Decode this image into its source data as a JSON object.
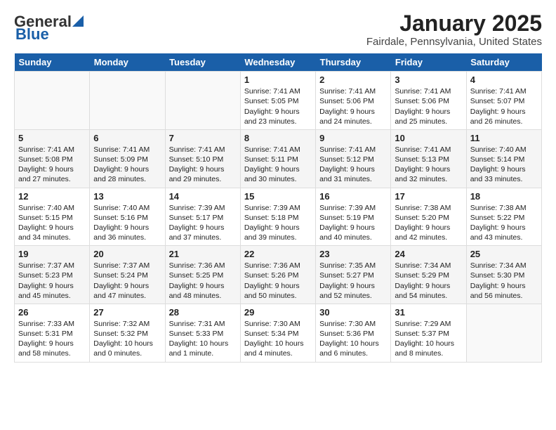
{
  "header": {
    "logo_general": "General",
    "logo_blue": "Blue",
    "month": "January 2025",
    "location": "Fairdale, Pennsylvania, United States"
  },
  "weekdays": [
    "Sunday",
    "Monday",
    "Tuesday",
    "Wednesday",
    "Thursday",
    "Friday",
    "Saturday"
  ],
  "weeks": [
    [
      {
        "day": "",
        "content": ""
      },
      {
        "day": "",
        "content": ""
      },
      {
        "day": "",
        "content": ""
      },
      {
        "day": "1",
        "content": "Sunrise: 7:41 AM\nSunset: 5:05 PM\nDaylight: 9 hours\nand 23 minutes."
      },
      {
        "day": "2",
        "content": "Sunrise: 7:41 AM\nSunset: 5:06 PM\nDaylight: 9 hours\nand 24 minutes."
      },
      {
        "day": "3",
        "content": "Sunrise: 7:41 AM\nSunset: 5:06 PM\nDaylight: 9 hours\nand 25 minutes."
      },
      {
        "day": "4",
        "content": "Sunrise: 7:41 AM\nSunset: 5:07 PM\nDaylight: 9 hours\nand 26 minutes."
      }
    ],
    [
      {
        "day": "5",
        "content": "Sunrise: 7:41 AM\nSunset: 5:08 PM\nDaylight: 9 hours\nand 27 minutes."
      },
      {
        "day": "6",
        "content": "Sunrise: 7:41 AM\nSunset: 5:09 PM\nDaylight: 9 hours\nand 28 minutes."
      },
      {
        "day": "7",
        "content": "Sunrise: 7:41 AM\nSunset: 5:10 PM\nDaylight: 9 hours\nand 29 minutes."
      },
      {
        "day": "8",
        "content": "Sunrise: 7:41 AM\nSunset: 5:11 PM\nDaylight: 9 hours\nand 30 minutes."
      },
      {
        "day": "9",
        "content": "Sunrise: 7:41 AM\nSunset: 5:12 PM\nDaylight: 9 hours\nand 31 minutes."
      },
      {
        "day": "10",
        "content": "Sunrise: 7:41 AM\nSunset: 5:13 PM\nDaylight: 9 hours\nand 32 minutes."
      },
      {
        "day": "11",
        "content": "Sunrise: 7:40 AM\nSunset: 5:14 PM\nDaylight: 9 hours\nand 33 minutes."
      }
    ],
    [
      {
        "day": "12",
        "content": "Sunrise: 7:40 AM\nSunset: 5:15 PM\nDaylight: 9 hours\nand 34 minutes."
      },
      {
        "day": "13",
        "content": "Sunrise: 7:40 AM\nSunset: 5:16 PM\nDaylight: 9 hours\nand 36 minutes."
      },
      {
        "day": "14",
        "content": "Sunrise: 7:39 AM\nSunset: 5:17 PM\nDaylight: 9 hours\nand 37 minutes."
      },
      {
        "day": "15",
        "content": "Sunrise: 7:39 AM\nSunset: 5:18 PM\nDaylight: 9 hours\nand 39 minutes."
      },
      {
        "day": "16",
        "content": "Sunrise: 7:39 AM\nSunset: 5:19 PM\nDaylight: 9 hours\nand 40 minutes."
      },
      {
        "day": "17",
        "content": "Sunrise: 7:38 AM\nSunset: 5:20 PM\nDaylight: 9 hours\nand 42 minutes."
      },
      {
        "day": "18",
        "content": "Sunrise: 7:38 AM\nSunset: 5:22 PM\nDaylight: 9 hours\nand 43 minutes."
      }
    ],
    [
      {
        "day": "19",
        "content": "Sunrise: 7:37 AM\nSunset: 5:23 PM\nDaylight: 9 hours\nand 45 minutes."
      },
      {
        "day": "20",
        "content": "Sunrise: 7:37 AM\nSunset: 5:24 PM\nDaylight: 9 hours\nand 47 minutes."
      },
      {
        "day": "21",
        "content": "Sunrise: 7:36 AM\nSunset: 5:25 PM\nDaylight: 9 hours\nand 48 minutes."
      },
      {
        "day": "22",
        "content": "Sunrise: 7:36 AM\nSunset: 5:26 PM\nDaylight: 9 hours\nand 50 minutes."
      },
      {
        "day": "23",
        "content": "Sunrise: 7:35 AM\nSunset: 5:27 PM\nDaylight: 9 hours\nand 52 minutes."
      },
      {
        "day": "24",
        "content": "Sunrise: 7:34 AM\nSunset: 5:29 PM\nDaylight: 9 hours\nand 54 minutes."
      },
      {
        "day": "25",
        "content": "Sunrise: 7:34 AM\nSunset: 5:30 PM\nDaylight: 9 hours\nand 56 minutes."
      }
    ],
    [
      {
        "day": "26",
        "content": "Sunrise: 7:33 AM\nSunset: 5:31 PM\nDaylight: 9 hours\nand 58 minutes."
      },
      {
        "day": "27",
        "content": "Sunrise: 7:32 AM\nSunset: 5:32 PM\nDaylight: 10 hours\nand 0 minutes."
      },
      {
        "day": "28",
        "content": "Sunrise: 7:31 AM\nSunset: 5:33 PM\nDaylight: 10 hours\nand 1 minute."
      },
      {
        "day": "29",
        "content": "Sunrise: 7:30 AM\nSunset: 5:34 PM\nDaylight: 10 hours\nand 4 minutes."
      },
      {
        "day": "30",
        "content": "Sunrise: 7:30 AM\nSunset: 5:36 PM\nDaylight: 10 hours\nand 6 minutes."
      },
      {
        "day": "31",
        "content": "Sunrise: 7:29 AM\nSunset: 5:37 PM\nDaylight: 10 hours\nand 8 minutes."
      },
      {
        "day": "",
        "content": ""
      }
    ]
  ]
}
